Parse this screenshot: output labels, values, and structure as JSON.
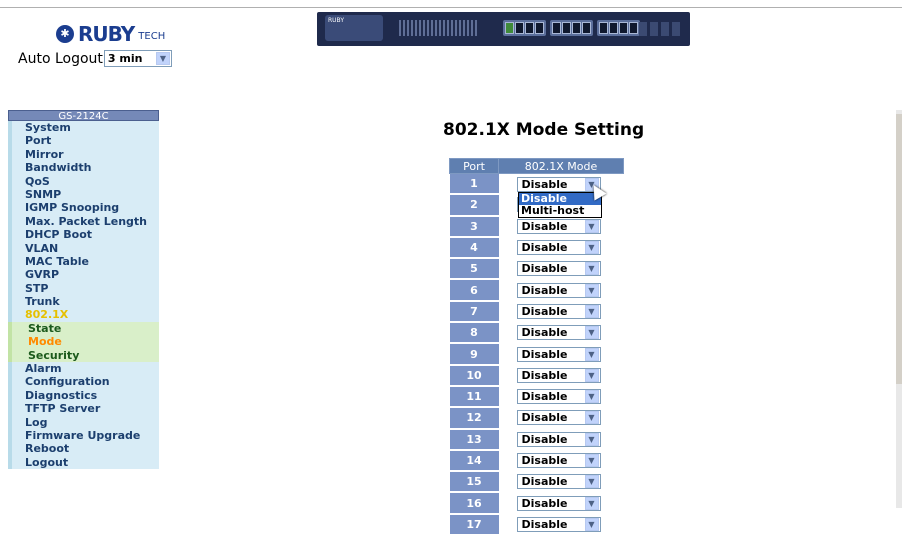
{
  "brand": {
    "logo_text": "RUBY",
    "logo_suffix": "TECH"
  },
  "auto_logout": {
    "label": "Auto Logout",
    "value": "3 min"
  },
  "switch_image": {
    "badge_text": "RUBY"
  },
  "sidebar": {
    "header": "GS-2124C",
    "items": [
      {
        "label": "System"
      },
      {
        "label": "Port"
      },
      {
        "label": "Mirror"
      },
      {
        "label": "Bandwidth"
      },
      {
        "label": "QoS"
      },
      {
        "label": "SNMP"
      },
      {
        "label": "IGMP Snooping"
      },
      {
        "label": "Max. Packet Length"
      },
      {
        "label": "DHCP Boot"
      },
      {
        "label": "VLAN"
      },
      {
        "label": "MAC Table"
      },
      {
        "label": "GVRP"
      },
      {
        "label": "STP"
      },
      {
        "label": "Trunk"
      },
      {
        "label": "802.1X"
      },
      {
        "label": "State"
      },
      {
        "label": "Mode"
      },
      {
        "label": "Security"
      },
      {
        "label": "Alarm"
      },
      {
        "label": "Configuration"
      },
      {
        "label": "Diagnostics"
      },
      {
        "label": "TFTP Server"
      },
      {
        "label": "Log"
      },
      {
        "label": "Firmware Upgrade"
      },
      {
        "label": "Reboot"
      },
      {
        "label": "Logout"
      }
    ]
  },
  "main": {
    "title": "802.1X Mode Setting",
    "table": {
      "headers": [
        "Port",
        "802.1X Mode"
      ],
      "rows": [
        {
          "port": "1",
          "mode": "Disable"
        },
        {
          "port": "2",
          "mode": "Disable"
        },
        {
          "port": "3",
          "mode": "Disable"
        },
        {
          "port": "4",
          "mode": "Disable"
        },
        {
          "port": "5",
          "mode": "Disable"
        },
        {
          "port": "6",
          "mode": "Disable"
        },
        {
          "port": "7",
          "mode": "Disable"
        },
        {
          "port": "8",
          "mode": "Disable"
        },
        {
          "port": "9",
          "mode": "Disable"
        },
        {
          "port": "10",
          "mode": "Disable"
        },
        {
          "port": "11",
          "mode": "Disable"
        },
        {
          "port": "12",
          "mode": "Disable"
        },
        {
          "port": "13",
          "mode": "Disable"
        },
        {
          "port": "14",
          "mode": "Disable"
        },
        {
          "port": "15",
          "mode": "Disable"
        },
        {
          "port": "16",
          "mode": "Disable"
        },
        {
          "port": "17",
          "mode": "Disable"
        }
      ]
    },
    "dropdown_options": [
      "Disable",
      "Multi-host"
    ]
  }
}
